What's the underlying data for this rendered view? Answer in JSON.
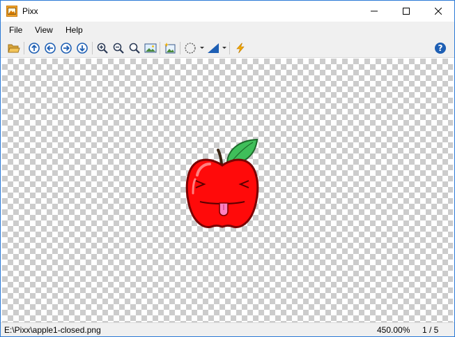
{
  "window": {
    "title": "Pixx"
  },
  "menu": {
    "file": "File",
    "view": "View",
    "help": "Help"
  },
  "toolbar": {
    "icons": [
      "open-folder-icon",
      "arrow-up-icon",
      "arrow-left-icon",
      "arrow-right-icon",
      "arrow-down-icon",
      "zoom-in-icon",
      "zoom-out-icon",
      "zoom-fit-icon",
      "picture-icon",
      "new-image-icon",
      "selection-icon",
      "brightness-icon",
      "lightning-icon",
      "help-icon"
    ]
  },
  "image": {
    "subject": "apple"
  },
  "status": {
    "path": "E:\\Pixx\\apple1-closed.png",
    "zoom": "450.00%",
    "page": "1 / 5"
  },
  "colors": {
    "accent": "#1e5fb4",
    "apple_red": "#ff0000",
    "leaf_green": "#3fbf5a"
  }
}
